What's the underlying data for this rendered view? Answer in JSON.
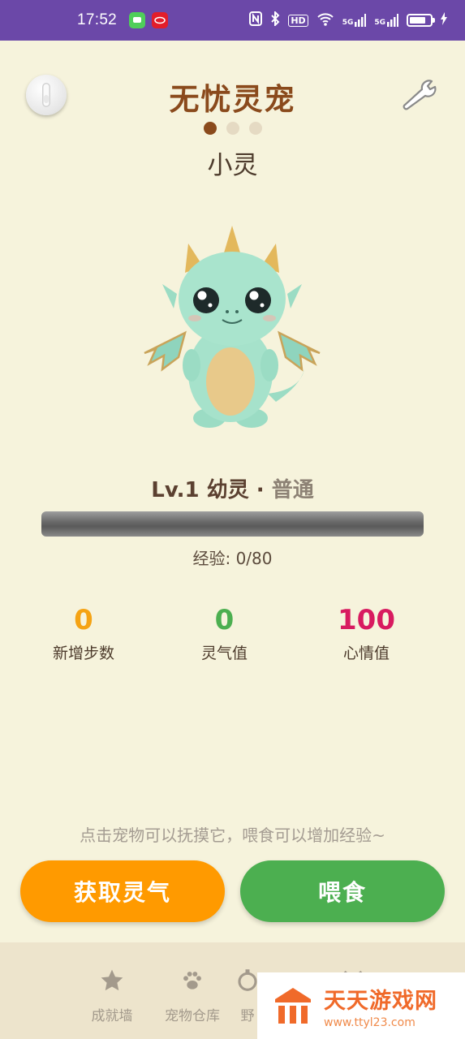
{
  "status_bar": {
    "time": "17:52",
    "indicators": [
      "N",
      "bluetooth",
      "HD",
      "wifi",
      "5G",
      "5G"
    ],
    "hd_label": "HD",
    "net1": "5G",
    "net2": "5G"
  },
  "header": {
    "title": "无忧灵宠",
    "page_dots": 3,
    "active_dot": 0
  },
  "pet": {
    "name": "小灵",
    "level_text": "Lv.1 幼灵 · ",
    "rarity": "普通",
    "exp_label": "经验: 0/80",
    "exp_progress": 0
  },
  "stats": [
    {
      "value": "0",
      "label": "新增步数",
      "color": "#f5a314"
    },
    {
      "value": "0",
      "label": "灵气值",
      "color": "#4caf50"
    },
    {
      "value": "100",
      "label": "心情值",
      "color": "#d81b60"
    }
  ],
  "hint": "点击宠物可以抚摸它，喂食可以增加经验~",
  "actions": {
    "get_aura": "获取灵气",
    "feed": "喂食"
  },
  "bottom_nav": {
    "items": [
      {
        "label": "成就墙",
        "icon": "star-icon"
      },
      {
        "label": "宠物仓库",
        "icon": "paw-icon"
      },
      {
        "label": "野",
        "icon": "timer-icon"
      },
      {
        "label": "",
        "icon": "sword-icon"
      }
    ]
  },
  "watermark": {
    "title": "天天游戏网",
    "url": "www.ttyl23.com"
  },
  "colors": {
    "background": "#f6f3dc",
    "status_bar": "#6b48a8",
    "title": "#8a4a1c",
    "orange_button": "#ff9a00",
    "green_button": "#4caf50",
    "nav_bg": "#ede4cc"
  }
}
